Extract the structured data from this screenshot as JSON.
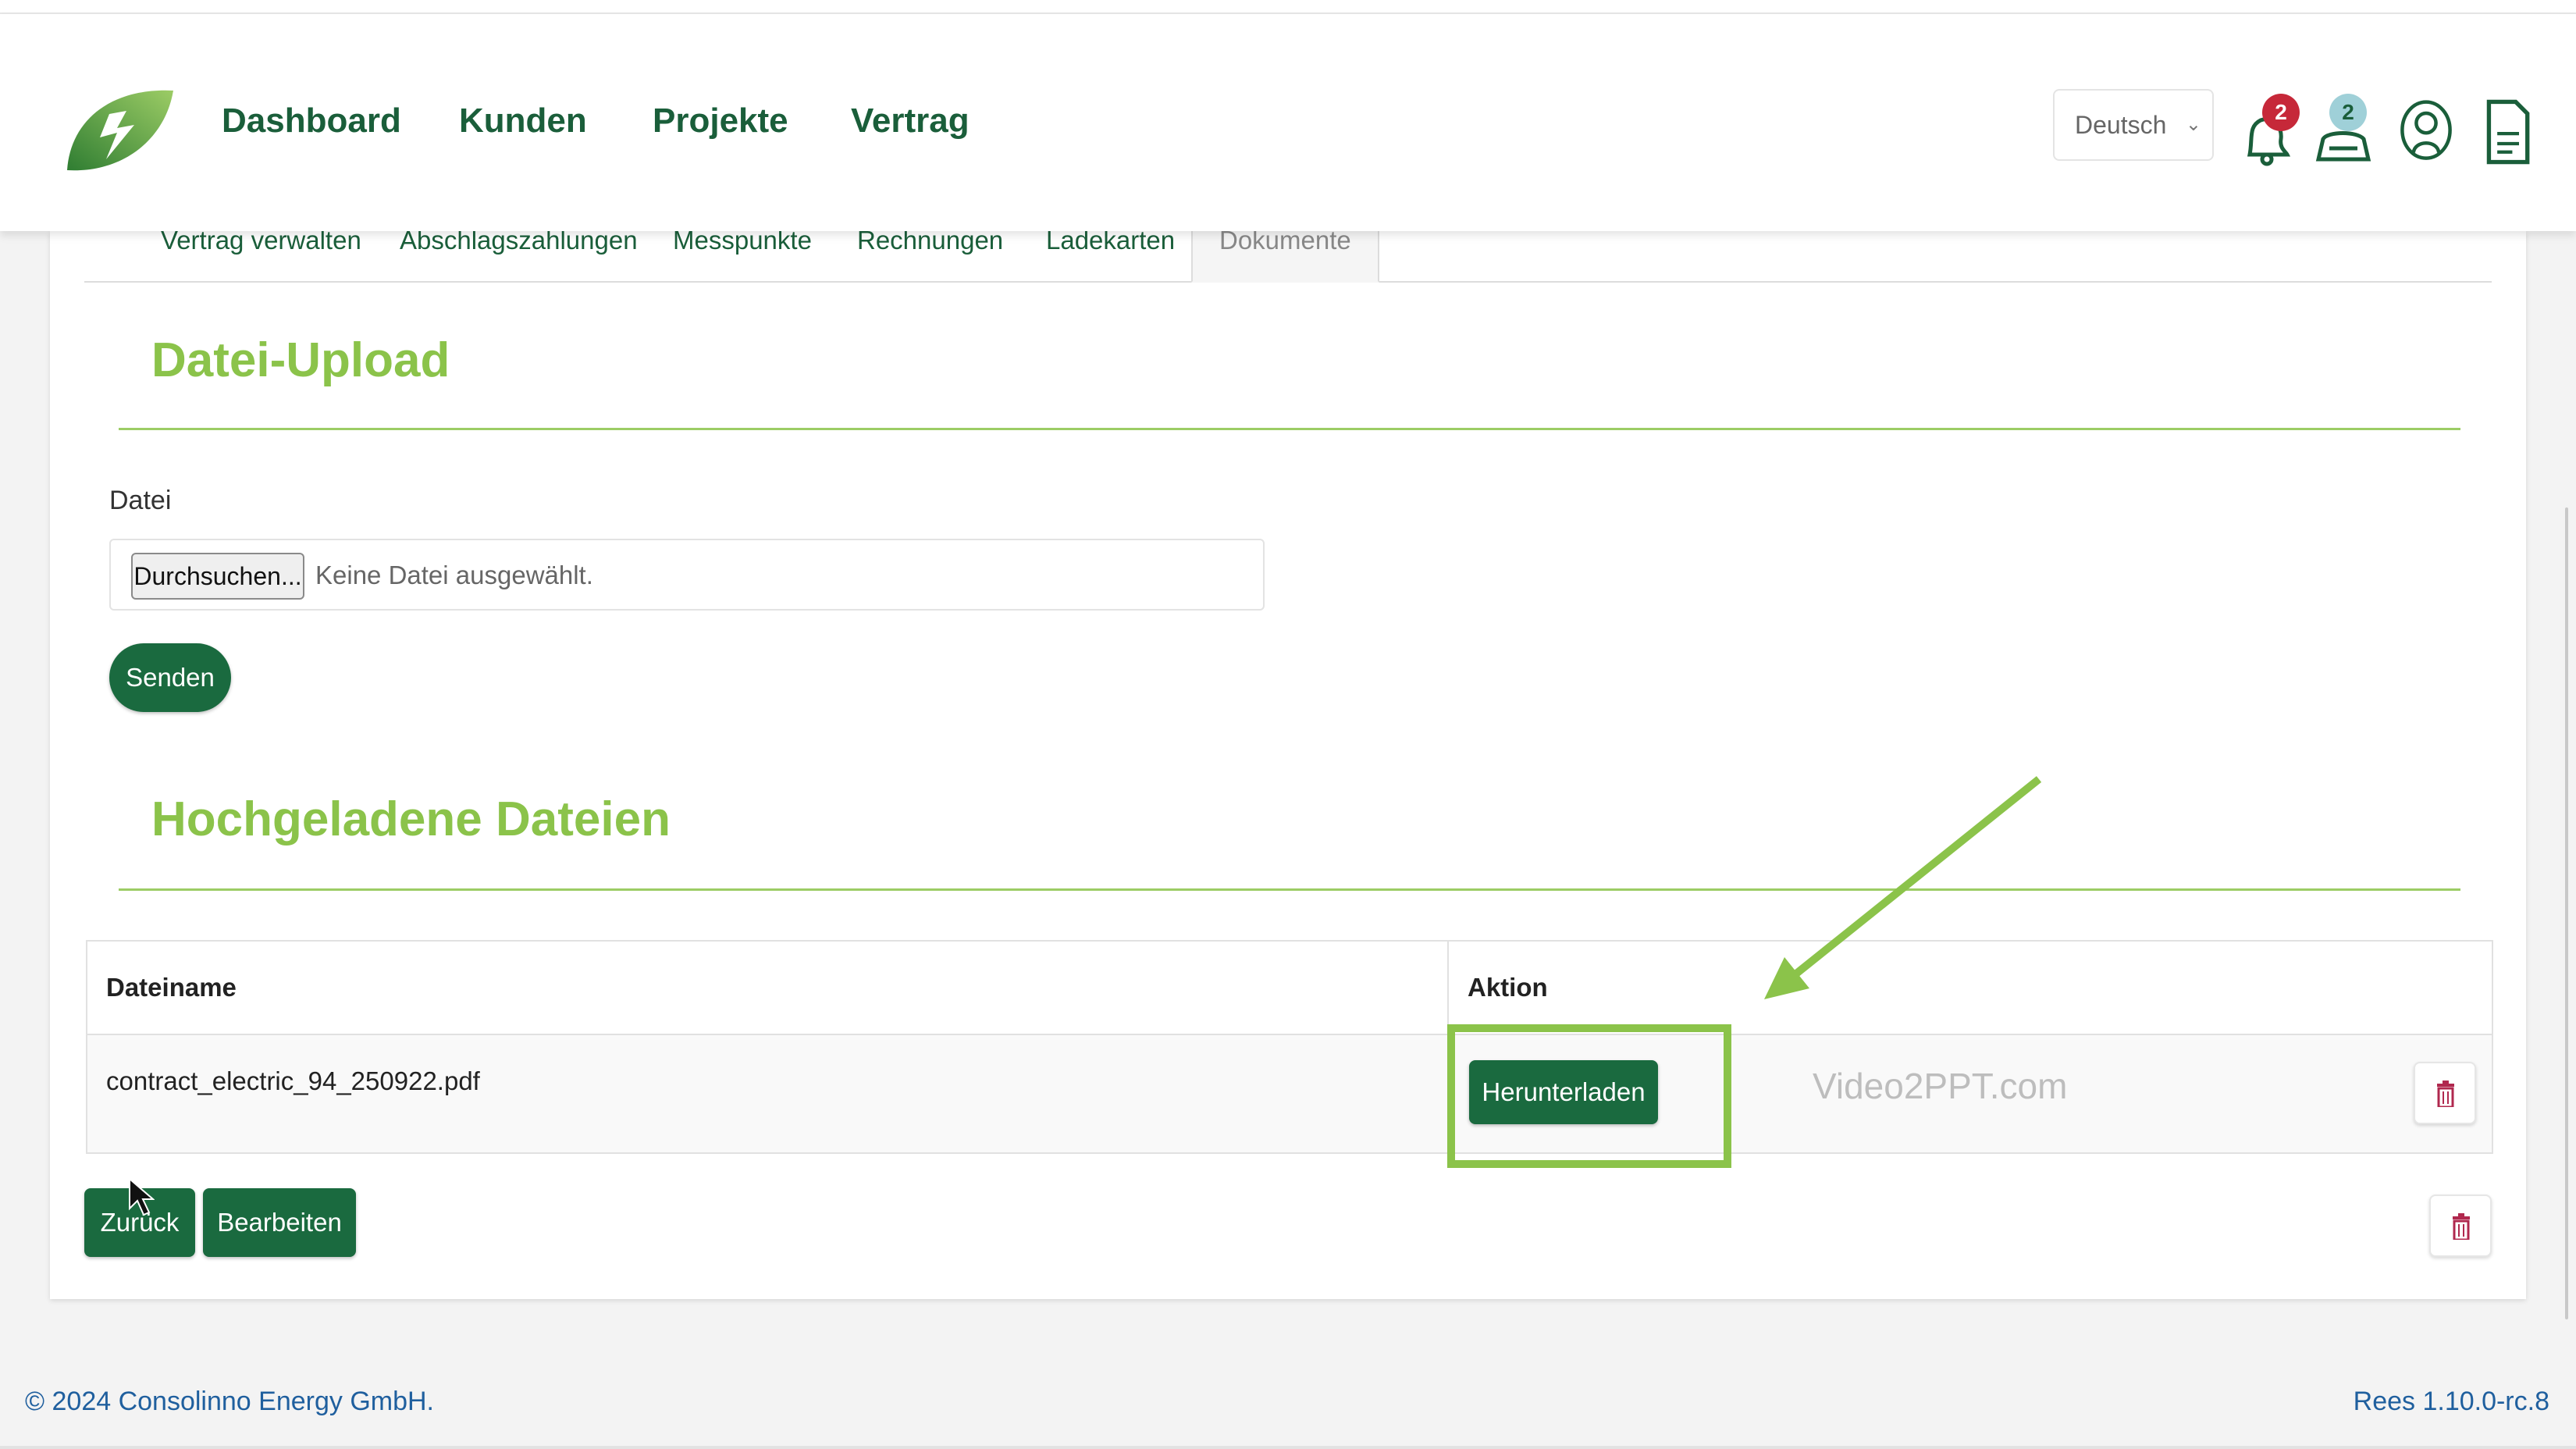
{
  "nav": {
    "items": [
      "Dashboard",
      "Kunden",
      "Projekte",
      "Vertrag"
    ]
  },
  "header": {
    "language": "Deutsch",
    "notifications_count": "2",
    "messages_count": "2"
  },
  "tabs": [
    {
      "label": "Vertrag verwalten",
      "active": false
    },
    {
      "label": "Abschlagszahlungen",
      "active": false
    },
    {
      "label": "Messpunkte",
      "active": false
    },
    {
      "label": "Rechnungen",
      "active": false
    },
    {
      "label": "Ladekarten",
      "active": false
    },
    {
      "label": "Dokumente",
      "active": true
    }
  ],
  "upload": {
    "title": "Datei-Upload",
    "file_label": "Datei",
    "browse_label": "Durchsuchen...",
    "file_status": "Keine Datei ausgewählt.",
    "submit_label": "Senden"
  },
  "files": {
    "title": "Hochgeladene Dateien",
    "columns": [
      "Dateiname",
      "Aktion"
    ],
    "rows": [
      {
        "filename": "contract_electric_94_250922.pdf",
        "action_label": "Herunterladen"
      }
    ]
  },
  "actions": {
    "back_label": "Zurück",
    "edit_label": "Bearbeiten"
  },
  "watermark": "Video2PPT.com",
  "footer": {
    "copyright": "© 2024 Consolinno Energy GmbH.",
    "version": "Rees 1.10.0-rc.8"
  },
  "colors": {
    "brand_green": "#1a6a3f",
    "accent_green": "#8bc34a",
    "badge_red": "#c62839",
    "badge_teal": "#7ab8c4",
    "link_blue": "#1f5f9e"
  },
  "icons": [
    "leaf-logo",
    "bell-icon",
    "chat-icon",
    "user-icon",
    "document-icon",
    "trash-icon",
    "arrow-annotation",
    "cursor-icon"
  ]
}
